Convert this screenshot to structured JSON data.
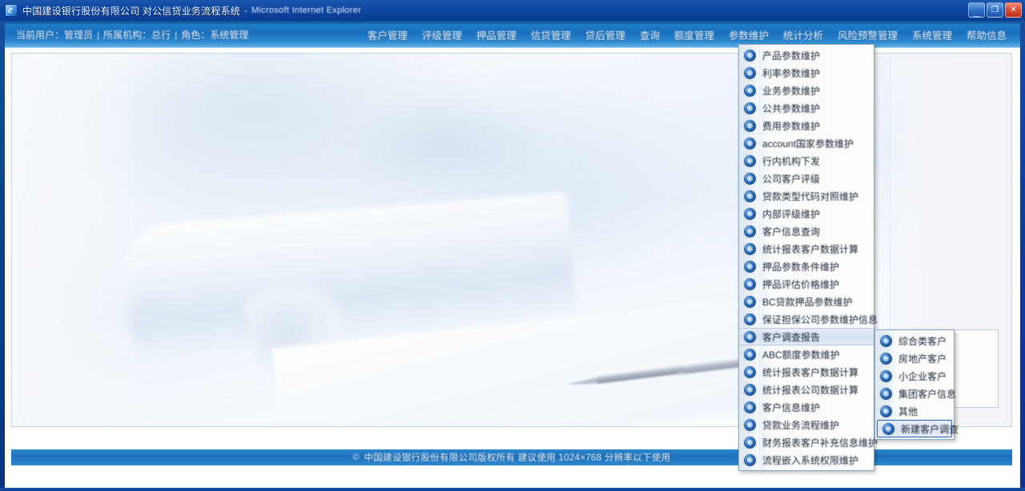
{
  "window": {
    "title": "中国建设银行股份有限公司 对公信贷业务流程系统",
    "title_separator": "-",
    "app_name": "Microsoft Internet Explorer",
    "buttons": {
      "minimize": "_",
      "maximize": "❐",
      "close": "✕"
    }
  },
  "breadcrumb": {
    "items": [
      "当前用户：管理员",
      "所属机构：总行",
      "角色：系统管理"
    ],
    "separator": "|"
  },
  "menubar": {
    "items": [
      {
        "label": "客户管理",
        "active": false
      },
      {
        "label": "评级管理",
        "active": false
      },
      {
        "label": "押品管理",
        "active": false
      },
      {
        "label": "信贷管理",
        "active": false
      },
      {
        "label": "贷后管理",
        "active": false
      },
      {
        "label": "查询",
        "active": false
      },
      {
        "label": "额度管理",
        "active": false
      },
      {
        "label": "参数维护",
        "active": true
      },
      {
        "label": "统计分析",
        "active": false
      },
      {
        "label": "风险预警管理",
        "active": false
      },
      {
        "label": "系统管理",
        "active": false
      },
      {
        "label": "帮助信息",
        "active": false
      }
    ]
  },
  "dropdown": {
    "owner": "参数维护",
    "items": [
      {
        "label": "产品参数维护",
        "selected": false,
        "has_submenu": false
      },
      {
        "label": "利率参数维护",
        "selected": false,
        "has_submenu": false
      },
      {
        "label": "业务参数维护",
        "selected": false,
        "has_submenu": false
      },
      {
        "label": "公共参数维护",
        "selected": false,
        "has_submenu": false
      },
      {
        "label": "费用参数维护",
        "selected": false,
        "has_submenu": false
      },
      {
        "label": "account国家参数维护",
        "selected": false,
        "has_submenu": false
      },
      {
        "label": "行内机构下发",
        "selected": false,
        "has_submenu": false
      },
      {
        "label": "公司客户评级",
        "selected": false,
        "has_submenu": false
      },
      {
        "label": "贷款类型代码对照维护",
        "selected": false,
        "has_submenu": false
      },
      {
        "label": "内部评级维护",
        "selected": false,
        "has_submenu": false
      },
      {
        "label": "客户信息查询",
        "selected": false,
        "has_submenu": false
      },
      {
        "label": "统计报表客户数据计算",
        "selected": false,
        "has_submenu": false
      },
      {
        "label": "押品参数条件维护",
        "selected": false,
        "has_submenu": false
      },
      {
        "label": "押品评估价格维护",
        "selected": false,
        "has_submenu": false
      },
      {
        "label": "BC贷款押品参数维护",
        "selected": false,
        "has_submenu": false
      },
      {
        "label": "保证担保公司参数维护信息",
        "selected": false,
        "has_submenu": false
      },
      {
        "label": "客户调查报告",
        "selected": true,
        "has_submenu": true
      },
      {
        "label": "ABC额度参数维护",
        "selected": false,
        "has_submenu": false
      },
      {
        "label": "统计报表客户数据计算",
        "selected": false,
        "has_submenu": false
      },
      {
        "label": "统计报表公司数据计算",
        "selected": false,
        "has_submenu": false
      },
      {
        "label": "客户信息维护",
        "selected": false,
        "has_submenu": false
      },
      {
        "label": "贷款业务流程维护",
        "selected": false,
        "has_submenu": false
      },
      {
        "label": "财务报表客户补充信息维护",
        "selected": false,
        "has_submenu": false
      },
      {
        "label": "流程嵌入系统权限维护",
        "selected": false,
        "has_submenu": false
      }
    ]
  },
  "submenu": {
    "parent": "客户调查报告",
    "items": [
      {
        "label": "综合类客户",
        "selected": false
      },
      {
        "label": "房地产客户",
        "selected": false
      },
      {
        "label": "小企业客户",
        "selected": false
      },
      {
        "label": "集团客户信息",
        "selected": false
      },
      {
        "label": "其他",
        "selected": false
      },
      {
        "label": "新建客户调查",
        "selected": true
      }
    ]
  },
  "footer": {
    "bullet": "©",
    "text": "中国建设银行股份有限公司版权所有  建议使用 1024×768 分辨率以下使用"
  }
}
